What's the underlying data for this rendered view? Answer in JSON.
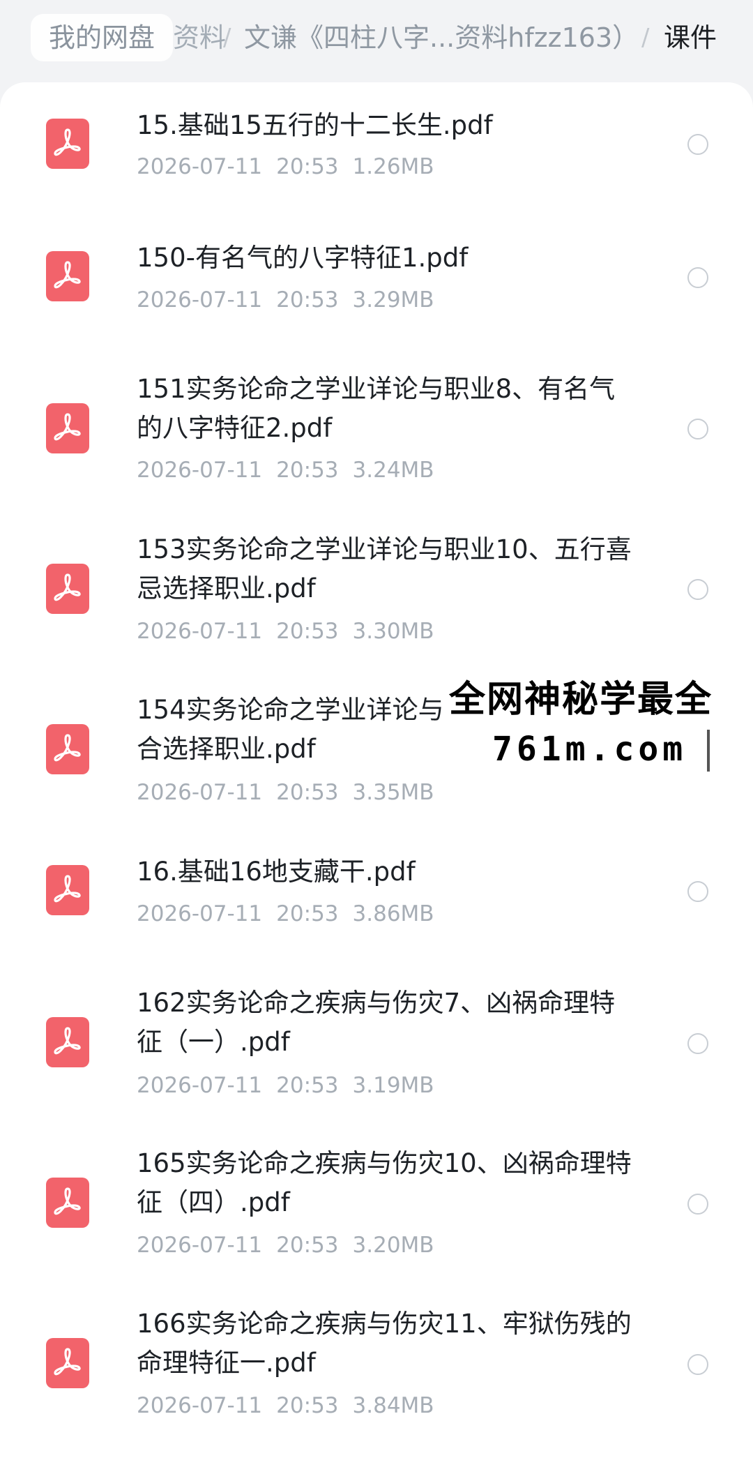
{
  "breadcrumb": {
    "home": "我的网盘",
    "prev": "资料",
    "separator": "/",
    "middle": "文谦《四柱八字...资料hfzz163）",
    "current": "课件"
  },
  "files": [
    {
      "name": "15.基础15五行的十二长生.pdf",
      "date": "2026-07-11",
      "time": "20:53",
      "size": "1.26MB",
      "icon": "pdf-file-icon"
    },
    {
      "name": "150-有名气的八字特征1.pdf",
      "date": "2026-07-11",
      "time": "20:53",
      "size": "3.29MB",
      "icon": "pdf-file-icon"
    },
    {
      "name": "151实务论命之学业详论与职业8、有名气的八字特征2.pdf",
      "date": "2026-07-11",
      "time": "20:53",
      "size": "3.24MB",
      "icon": "pdf-file-icon"
    },
    {
      "name": "153实务论命之学业详论与职业10、五行喜忌选择职业.pdf",
      "date": "2026-07-11",
      "time": "20:53",
      "size": "3.30MB",
      "icon": "pdf-file-icon"
    },
    {
      "name": "154实务论命之学业详论与职业11、五行组合选择职业.pdf",
      "date": "2026-07-11",
      "time": "20:53",
      "size": "3.35MB",
      "icon": "pdf-file-icon"
    },
    {
      "name": "16.基础16地支藏干.pdf",
      "date": "2026-07-11",
      "time": "20:53",
      "size": "3.86MB",
      "icon": "pdf-file-icon"
    },
    {
      "name": "162实务论命之疾病与伤灾7、凶祸命理特征（一）.pdf",
      "date": "2026-07-11",
      "time": "20:53",
      "size": "3.19MB",
      "icon": "pdf-file-icon"
    },
    {
      "name": "165实务论命之疾病与伤灾10、凶祸命理特征（四）.pdf",
      "date": "2026-07-11",
      "time": "20:53",
      "size": "3.20MB",
      "icon": "pdf-file-icon"
    },
    {
      "name": "166实务论命之疾病与伤灾11、牢狱伤残的命理特征一.pdf",
      "date": "2026-07-11",
      "time": "20:53",
      "size": "3.84MB",
      "icon": "pdf-file-icon"
    }
  ],
  "watermark": {
    "line1": "全网神秘学最全",
    "line2": "761m.com"
  },
  "colors": {
    "pdf_icon": "#f2636b",
    "background": "#f2f3f5",
    "panel": "#ffffff",
    "meta_text": "#a6adb5"
  }
}
